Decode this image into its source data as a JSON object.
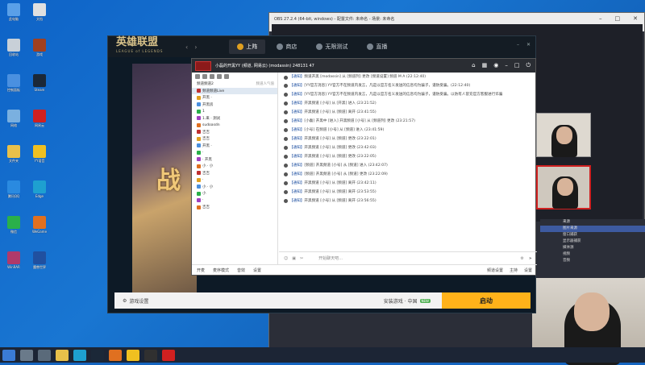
{
  "lol": {
    "logo": "英雄联盟",
    "logo_sub": "LEAGUE of LEGENDS",
    "tabs": [
      {
        "label": "上阵",
        "active": true
      },
      {
        "label": "商店",
        "active": false
      },
      {
        "label": "无限测试",
        "active": false
      },
      {
        "label": "直播",
        "active": false
      }
    ],
    "art_text": "战",
    "settings_label": "游戏设置",
    "launcher_label": "安装游戏 · 中国",
    "launcher_badge": "NEW",
    "start_label": "启动"
  },
  "yy": {
    "title": "小磊的开黑YY (频道, 网易云) (modassin)  248131  47",
    "left_header": "频道频道2",
    "left_hint": "频道人气值",
    "left_items": [
      "频道频道Live",
      "开黑 ·",
      "开黑房",
      "1",
      "1.来 · 测试",
      "sudoasdn",
      "吉吉",
      "吉吉",
      "开黑 ·",
      "·",
      "· 开黑",
      "小 · 小",
      "吉吉",
      "·",
      "小 · 小",
      "小",
      "·",
      "吉吉"
    ],
    "messages": [
      {
        "tag": "【通知】",
        "text": "频道开黑 [modassin] 从 [频道列] 更改 [频道设置] 频道 M A  (22:12:40)"
      },
      {
        "tag": "【通知】",
        "text": "[YY官方消息] YY官方不在频道内发言，凡是以官方名义发送的信息均为骗子，谨防受骗。(22:12:40)"
      },
      {
        "tag": "【通知】",
        "text": "[YY官方消息] YY官方不在频道内发言，凡是以官方名义发送的信息均为骗子，谨防受骗。以防有人冒充官方客服进行诈骗"
      },
      {
        "tag": "【通知】",
        "text": "开黑频道 [小号] 从 [开黑] 进入 (23:21:52)"
      },
      {
        "tag": "【通知】",
        "text": "开黑频道 [小号] 从 [频道] 离开 (23:41:55)"
      },
      {
        "tag": "【通知】",
        "text": "[小磊] 开黑中 [进入] 开黑频道 [小号] 从 [频道列] 更改 (23:21:57)"
      },
      {
        "tag": "【通知】",
        "text": "[小号] 在频道 [小号] 从 [频道] 进入 (23:41:59)"
      },
      {
        "tag": "【通知】",
        "text": "开黑频道 [小号] 从 [频道] 更改 (23:22:01)"
      },
      {
        "tag": "【通知】",
        "text": "开黑频道 [小号] 从 [频道] 更改 (23:42:03)"
      },
      {
        "tag": "【通知】",
        "text": "开黑频道 [小号] 从 [频道] 更改 (23:22:05)"
      },
      {
        "tag": "【通知】",
        "text": "[频道] 开黑频道 [小号] 从 [频道] 进入 (23:42:07)"
      },
      {
        "tag": "【通知】",
        "text": "[频道] 开黑频道 [小号] 从 [频道] 更改 (23:22:09)"
      },
      {
        "tag": "【通知】",
        "text": "开黑频道 [小号] 从 [频道] 离开 (23:42:11)"
      },
      {
        "tag": "【通知】",
        "text": "开黑频道 [小号] 从 [频道] 离开 (23:53:55)"
      },
      {
        "tag": "【通知】",
        "text": "开黑频道 [小号] 从 [频道] 离开 (23:56:55)"
      }
    ],
    "input_placeholder": "开始聊天吧...",
    "foot_items": [
      "开麦",
      "麦序模式",
      "音效",
      "设置"
    ],
    "foot_right": [
      "频道设置",
      "主持",
      "设置"
    ]
  },
  "obs": {
    "title": "OBS 27.2.4 (64-bit, windows) - 配置文件: 未命名 - 场景: 未命名",
    "sources": [
      "来源",
      "图片来源",
      "窗口捕获",
      "显示器捕获",
      "媒体源",
      "视频",
      "音频"
    ]
  },
  "desktop": {
    "icons": [
      {
        "label": "此电脑",
        "color": "#5aa0e8"
      },
      {
        "label": "回收站",
        "color": "#c8d0d8"
      },
      {
        "label": "控制面板",
        "color": "#4a90e0"
      },
      {
        "label": "网络",
        "color": "#7ab0e0"
      },
      {
        "label": "文件夹",
        "color": "#e8c04a"
      },
      {
        "label": "腾讯QQ",
        "color": "#2a8ae0"
      },
      {
        "label": "微信",
        "color": "#2ab04a"
      },
      {
        "label": "WinRAR",
        "color": "#b03a6a"
      },
      {
        "label": "文档",
        "color": "#e0e0e0"
      },
      {
        "label": "游戏",
        "color": "#a04020"
      },
      {
        "label": "Steam",
        "color": "#1b2838"
      },
      {
        "label": "网易云",
        "color": "#d02020"
      },
      {
        "label": "YY语音",
        "color": "#f0c020"
      },
      {
        "label": "Edge",
        "color": "#1ea0d0"
      },
      {
        "label": "WeGame",
        "color": "#e07020"
      },
      {
        "label": "魔兽世界",
        "color": "#2050a0"
      }
    ]
  },
  "taskbar": {
    "items": [
      "开始",
      "搜索",
      "任务视图",
      "资源管理器",
      "Edge",
      "Steam",
      "WeGame",
      "YY",
      "OBS",
      "网易云"
    ]
  }
}
